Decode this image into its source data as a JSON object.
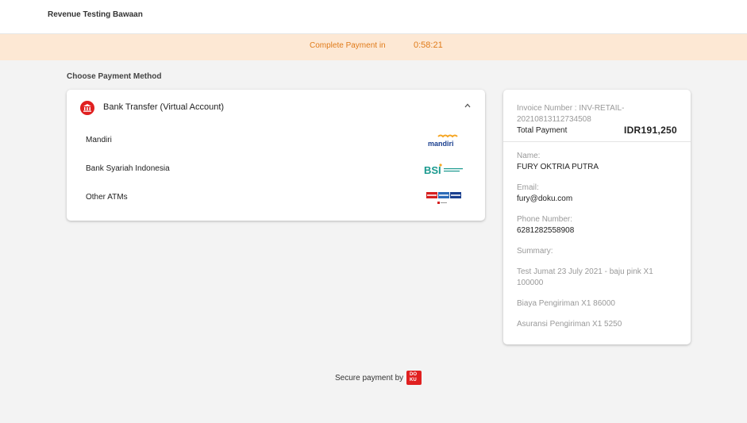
{
  "header": {
    "brand": "Revenue Testing Bawaan"
  },
  "timer": {
    "label": "Complete Payment in",
    "value": "0:58:21"
  },
  "payment": {
    "section_title": "Choose Payment Method",
    "method_title": "Bank Transfer (Virtual Account)",
    "options": [
      {
        "label": "Mandiri",
        "logo": "mandiri-logo"
      },
      {
        "label": "Bank Syariah Indonesia",
        "logo": "bsi-logo"
      },
      {
        "label": "Other ATMs",
        "logo": "atm-network-logos"
      }
    ],
    "logo_text": {
      "mandiri": "mandiri",
      "bsi": "BSI"
    }
  },
  "invoice": {
    "number": "Invoice Number : INV-RETAIL-20210813112734508",
    "total_label": "Total Payment",
    "total_value": "IDR191,250",
    "name_label": "Name:",
    "name_value": "FURY OKTRIA PUTRA",
    "email_label": "Email:",
    "email_value": "fury@doku.com",
    "phone_label": "Phone Number:",
    "phone_value": "6281282558908",
    "summary_label": "Summary:",
    "summary_items": [
      "Test Jumat 23 July 2021 - baju pink X1 100000",
      "Biaya Pengiriman X1 86000",
      "Asuransi Pengiriman X1 5250"
    ]
  },
  "footer": {
    "text": "Secure payment by",
    "logo_text_top": "DO",
    "logo_text_bottom": "KU"
  },
  "colors": {
    "accent": "#e02020",
    "timer": "#e07b1a",
    "timer_bg": "#fde8d4",
    "background": "#f3f3f3"
  }
}
